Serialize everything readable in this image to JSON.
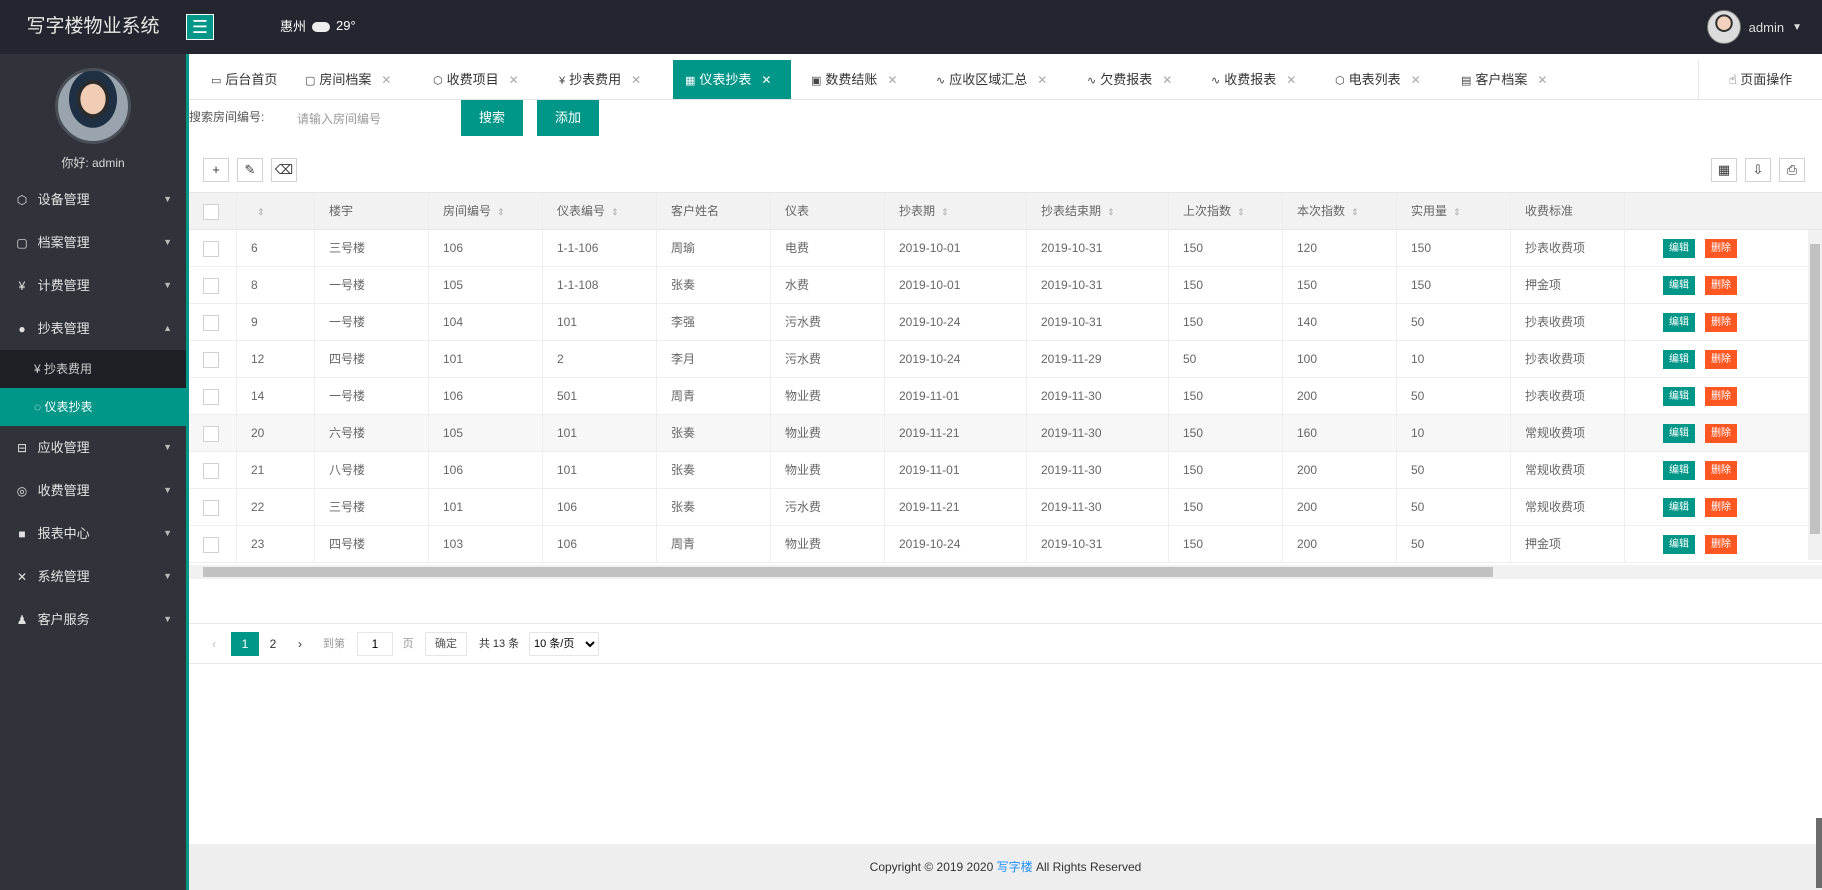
{
  "app": {
    "title": "写字楼物业系统",
    "menu_icon": "hamburger-icon"
  },
  "header": {
    "city": "惠州",
    "temperature": "29°",
    "weather_icon": "cloud-icon",
    "user": "admin"
  },
  "sidebar": {
    "greeting": "你好: admin",
    "items": [
      {
        "label": "设备管理",
        "icon": "cube-icon",
        "expanded": false
      },
      {
        "label": "档案管理",
        "icon": "file-icon",
        "expanded": false
      },
      {
        "label": "计费管理",
        "icon": "yen-icon",
        "expanded": false
      },
      {
        "label": "抄表管理",
        "icon": "drop-icon",
        "expanded": true
      },
      {
        "label": "应收管理",
        "icon": "receipt-icon",
        "expanded": false
      },
      {
        "label": "收费管理",
        "icon": "coin-icon",
        "expanded": false
      },
      {
        "label": "报表中心",
        "icon": "chart-icon",
        "expanded": false
      },
      {
        "label": "系统管理",
        "icon": "tools-icon",
        "expanded": false
      },
      {
        "label": "客户服务",
        "icon": "user-icon",
        "expanded": false
      }
    ],
    "subitems": [
      {
        "label": "抄表费用",
        "active": false
      },
      {
        "label": "仪表抄表",
        "active": true
      }
    ]
  },
  "tabs": [
    {
      "label": "后台首页",
      "icon": "monitor-icon",
      "closable": false,
      "active": false
    },
    {
      "label": "房间档案",
      "icon": "file-icon",
      "closable": true,
      "active": false
    },
    {
      "label": "收费项目",
      "icon": "cube-icon",
      "closable": true,
      "active": false
    },
    {
      "label": "抄表费用",
      "icon": "yen-icon",
      "closable": true,
      "active": false
    },
    {
      "label": "仪表抄表",
      "icon": "meter-icon",
      "closable": true,
      "active": true
    },
    {
      "label": "数费结账",
      "icon": "calc-icon",
      "closable": true,
      "active": false
    },
    {
      "label": "应收区域汇总",
      "icon": "pulse-icon",
      "closable": true,
      "active": false
    },
    {
      "label": "欠费报表",
      "icon": "pulse-icon",
      "closable": true,
      "active": false
    },
    {
      "label": "收费报表",
      "icon": "pulse-icon",
      "closable": true,
      "active": false
    },
    {
      "label": "电表列表",
      "icon": "cube-icon",
      "closable": true,
      "active": false
    },
    {
      "label": "客户档案",
      "icon": "file-icon",
      "closable": true,
      "active": false
    }
  ],
  "page_ops": "页面操作",
  "search": {
    "label": "搜索房间编号:",
    "placeholder": "请输入房间编号",
    "search_btn": "搜索",
    "add_btn": "添加"
  },
  "table": {
    "columns": [
      "",
      "楼宇",
      "房间编号",
      "仪表编号",
      "客户姓名",
      "仪表",
      "抄表期",
      "抄表结束期",
      "上次指数",
      "本次指数",
      "实用量",
      "收费标准"
    ],
    "sortable": [
      true,
      false,
      true,
      true,
      false,
      false,
      true,
      true,
      true,
      true,
      true,
      false
    ],
    "rows": [
      [
        "6",
        "三号楼",
        "106",
        "1-1-106",
        "周瑜",
        "电费",
        "2019-10-01",
        "2019-10-31",
        "150",
        "120",
        "150",
        "抄表收费项"
      ],
      [
        "8",
        "一号楼",
        "105",
        "1-1-108",
        "张奏",
        "水费",
        "2019-10-01",
        "2019-10-31",
        "150",
        "150",
        "150",
        "押金项"
      ],
      [
        "9",
        "一号楼",
        "104",
        "101",
        "李强",
        "污水费",
        "2019-10-24",
        "2019-10-31",
        "150",
        "140",
        "50",
        "抄表收费项"
      ],
      [
        "12",
        "四号楼",
        "101",
        "2",
        "李月",
        "污水费",
        "2019-10-24",
        "2019-11-29",
        "50",
        "100",
        "10",
        "抄表收费项"
      ],
      [
        "14",
        "一号楼",
        "106",
        "501",
        "周青",
        "物业费",
        "2019-11-01",
        "2019-11-30",
        "150",
        "200",
        "50",
        "抄表收费项"
      ],
      [
        "20",
        "六号楼",
        "105",
        "101",
        "张奏",
        "物业费",
        "2019-11-21",
        "2019-11-30",
        "150",
        "160",
        "10",
        "常规收费项"
      ],
      [
        "21",
        "八号楼",
        "106",
        "101",
        "张奏",
        "物业费",
        "2019-11-01",
        "2019-11-30",
        "150",
        "200",
        "50",
        "常规收费项"
      ],
      [
        "22",
        "三号楼",
        "101",
        "106",
        "张奏",
        "污水费",
        "2019-11-21",
        "2019-11-30",
        "150",
        "200",
        "50",
        "常规收费项"
      ],
      [
        "23",
        "四号楼",
        "103",
        "106",
        "周青",
        "物业费",
        "2019-10-24",
        "2019-10-31",
        "150",
        "200",
        "50",
        "押金项"
      ]
    ],
    "edit_label": "编辑",
    "delete_label": "删除"
  },
  "pager": {
    "prev": "‹",
    "current": "1",
    "page2": "2",
    "next": "›",
    "goto_label": "到第",
    "goto_value": "1",
    "page_unit": "页",
    "confirm": "确定",
    "total": "共 13 条",
    "per_page": "10 条/页"
  },
  "footer": {
    "copyright": "Copyright © 2019 2020 ",
    "brand": "写字楼",
    "rights": " All Rights Reserved"
  },
  "colors": {
    "accent": "#009688",
    "danger": "#ff5722",
    "header": "#23262e",
    "sidebar": "#30333a"
  }
}
